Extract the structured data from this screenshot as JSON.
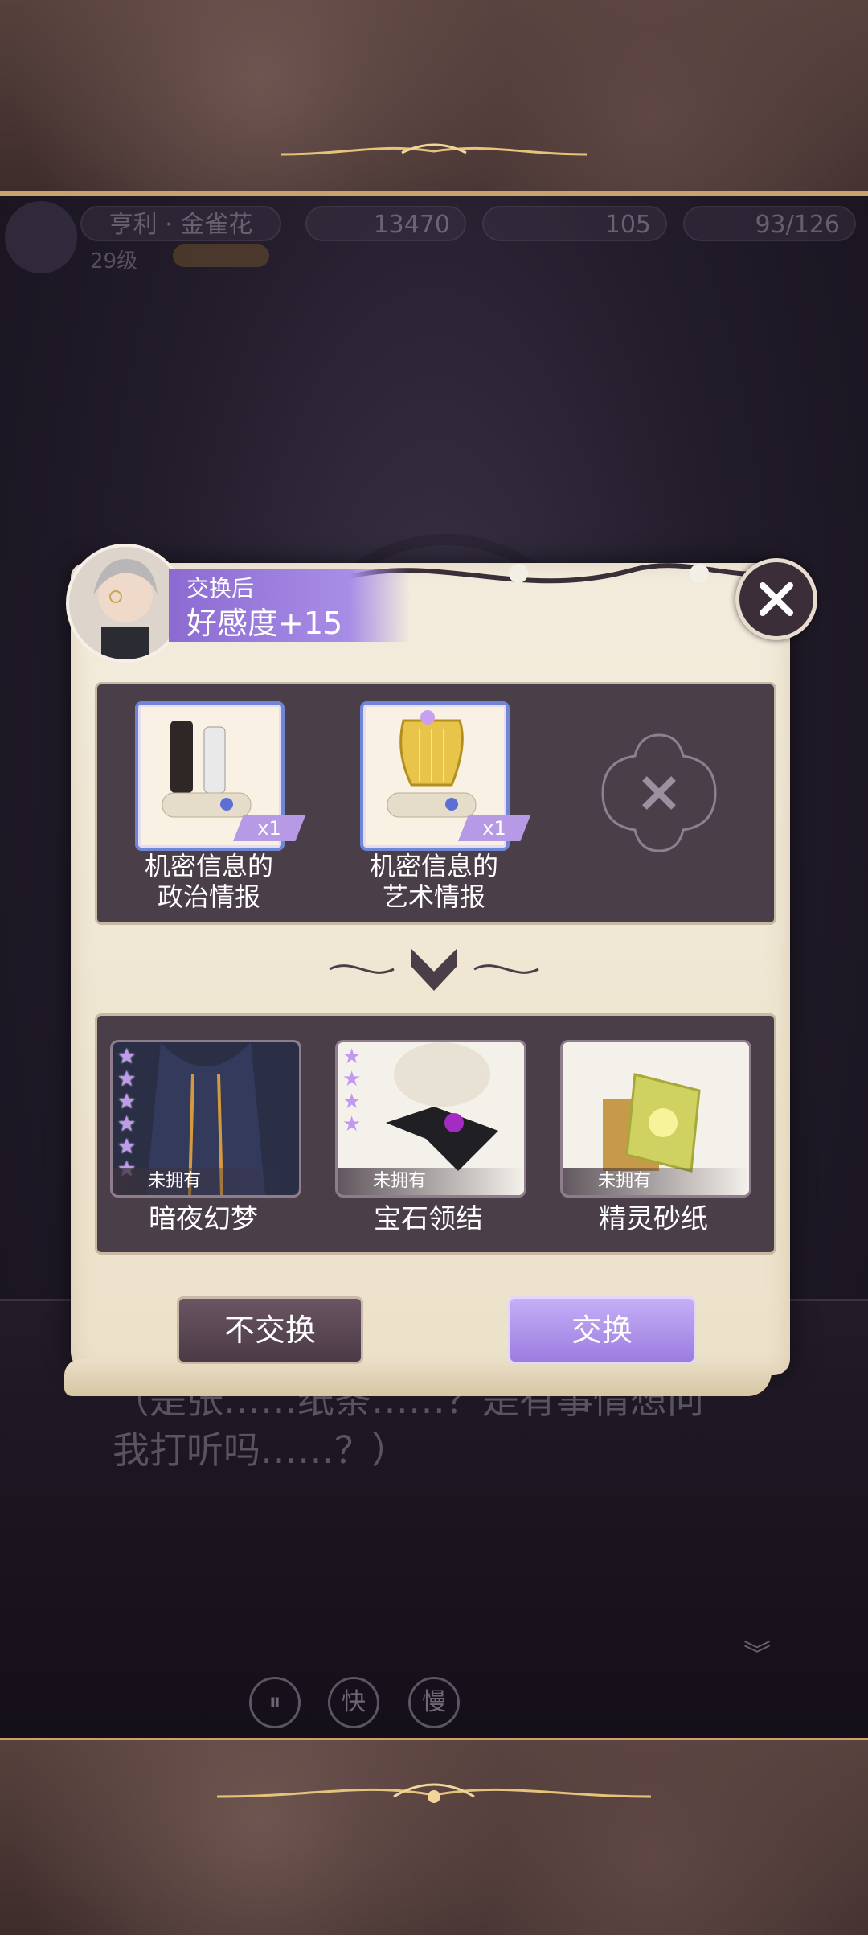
{
  "hud": {
    "character_name": "亨利 · 金雀花",
    "level": "29级",
    "gold": "13470",
    "gems": "105",
    "stamina": "93/126"
  },
  "dialog": {
    "line1": "（是张……纸条……？是有事情想问",
    "line2": "我打听吗……？）"
  },
  "controls": {
    "pause": "⏸",
    "fast": "快",
    "slow": "慢"
  },
  "modal": {
    "affinity_label": "交换后",
    "affinity_value": "好感度+15",
    "close_icon": "close-icon",
    "cost_items": [
      {
        "name_line1": "机密信息的",
        "name_line2": "政治情报",
        "qty": "x1",
        "icon": "chess-scroll-icon"
      },
      {
        "name_line1": "机密信息的",
        "name_line2": "艺术情报",
        "qty": "x1",
        "icon": "harp-scroll-icon"
      }
    ],
    "rewards": [
      {
        "name": "暗夜幻梦",
        "status": "未拥有",
        "stars": 6
      },
      {
        "name": "宝石领结",
        "status": "未拥有",
        "stars": 4
      },
      {
        "name": "精灵砂纸",
        "status": "未拥有",
        "stars": 0
      }
    ],
    "cancel_label": "不交换",
    "confirm_label": "交换"
  },
  "colors": {
    "accent": "#a88de6",
    "panel": "#4a3f48",
    "parchment": "#f3ecdd"
  }
}
